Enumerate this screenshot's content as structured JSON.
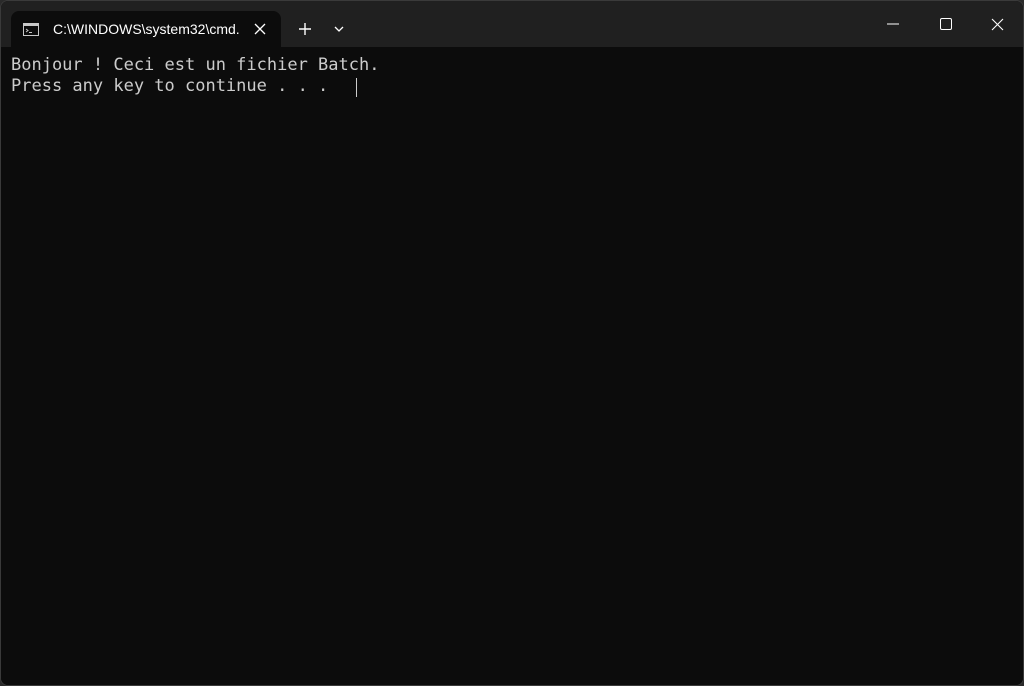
{
  "window": {
    "tab_title": "C:\\WINDOWS\\system32\\cmd.",
    "tab_icon": "terminal-icon",
    "close_tab_icon": "close-icon",
    "new_tab_icon": "plus-icon",
    "dropdown_icon": "chevron-down-icon",
    "minimize_icon": "minimize-icon",
    "maximize_icon": "maximize-icon",
    "close_icon": "close-icon"
  },
  "console": {
    "lines": [
      "Bonjour ! Ceci est un fichier Batch.",
      "Press any key to continue . . . "
    ]
  },
  "colors": {
    "titlebar_bg": "#202020",
    "console_bg": "#0c0c0c",
    "text": "#cccccc"
  }
}
